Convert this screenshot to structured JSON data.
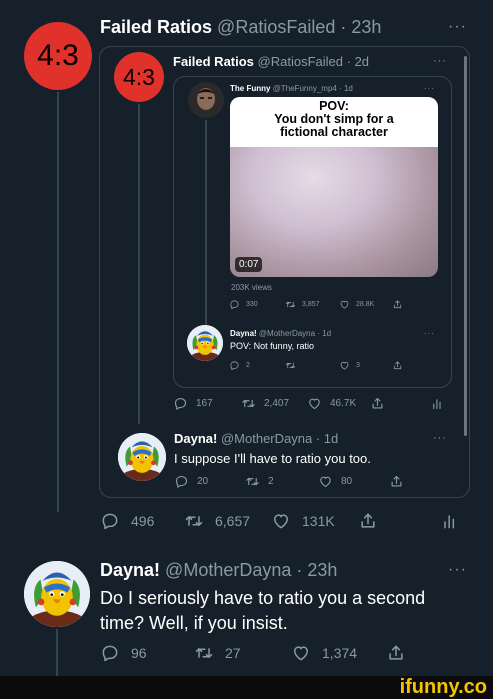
{
  "tweet1": {
    "avatar_text": "4:3",
    "name": "Failed Ratios",
    "handle": "@RatiosFailed",
    "time": "· 23h",
    "more": "···",
    "replies": "496",
    "retweets": "6,657",
    "likes": "131K"
  },
  "tweet2": {
    "avatar_text": "4:3",
    "name": "Failed Ratios",
    "handle": "@RatiosFailed",
    "time": "· 2d",
    "more": "···",
    "replies": "167",
    "retweets": "2,407",
    "likes": "46.7K"
  },
  "tweet3": {
    "name": "The Funny",
    "handle": "@TheFunny_mp4",
    "time": "· 1d",
    "more": "···",
    "caption_line1": "POV:",
    "caption_line2": "You don't simp for a",
    "caption_line3": "fictional character",
    "duration": "0:07",
    "views": "203K views",
    "replies": "330",
    "retweets": "3,857",
    "likes": "28.8K"
  },
  "tweet4": {
    "name": "Dayna!",
    "handle": "@MotherDayna",
    "time": "· 1d",
    "more": "···",
    "text": "POV: Not funny, ratio",
    "replies": "2",
    "retweets": "",
    "likes": "3"
  },
  "tweet5": {
    "name": "Dayna!",
    "handle": "@MotherDayna",
    "time": "· 1d",
    "more": "···",
    "text": "I suppose I'll have to ratio you too.",
    "replies": "20",
    "retweets": "2",
    "likes": "80"
  },
  "tweet6": {
    "name": "Dayna!",
    "handle": "@MotherDayna",
    "time": "· 23h",
    "more": "···",
    "text_line1": "Do I seriously have to ratio you a second",
    "text_line2": "time? Well, if you insist.",
    "replies": "96",
    "retweets": "27",
    "likes": "1,374"
  },
  "watermark": "ifunny.co",
  "colors": {
    "background": "#15202b",
    "muted": "#8b98a5",
    "avatar_red": "#e0312b",
    "border": "#38444d"
  }
}
